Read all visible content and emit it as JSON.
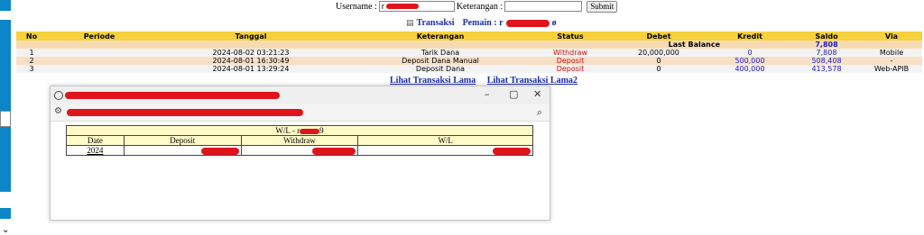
{
  "search": {
    "username_label": "Username :",
    "username_value": "r",
    "keterangan_label": "Keterangan :",
    "keterangan_value": "",
    "submit_label": "Submit"
  },
  "header": {
    "transaksi_label": "Transaksi",
    "pemain_label": "Pemain : r",
    "suffix": "ø"
  },
  "table": {
    "columns": [
      "No",
      "Periode",
      "Tanggal",
      "Keterangan",
      "Status",
      "Debet",
      "Kredit",
      "Saldo",
      "Via"
    ],
    "last_balance_label": "Last Balance",
    "last_balance_value": "7,808",
    "rows": [
      {
        "no": "1",
        "periode": "",
        "tanggal": "2024-08-02 03:21:23",
        "keterangan": "Tarik Dana",
        "status": "Withdraw",
        "debet": "20,000,000",
        "kredit": "0",
        "saldo": "7,808",
        "via": "Mobile"
      },
      {
        "no": "2",
        "periode": "",
        "tanggal": "2024-08-01 16:30:49",
        "keterangan": "Deposit Dana Manual",
        "status": "Deposit",
        "debet": "0",
        "kredit": "500,000",
        "saldo": "508,408",
        "via": "-"
      },
      {
        "no": "3",
        "periode": "",
        "tanggal": "2024-08-01 13:29:24",
        "keterangan": "Deposit Dana",
        "status": "Deposit",
        "debet": "0",
        "kredit": "400,000",
        "saldo": "413,578",
        "via": "Web-APIB"
      }
    ]
  },
  "links": {
    "old1": "Lihat Transaksi Lama",
    "old2": "Lihat Transaksi Lama2"
  },
  "popup": {
    "minimize": "–",
    "maximize": "▢",
    "close": "✕",
    "wl_title_prefix": "W/L - r",
    "wl_title_suffix": "9",
    "columns": [
      "Date",
      "Deposit",
      "Withdraw",
      "W/L"
    ],
    "row_date": "2024"
  },
  "colors": {
    "header_bg": "#f6d13b",
    "link_blue": "#1a2aa8",
    "withdraw_red": "#d01010",
    "redaction": "#e0141c"
  }
}
